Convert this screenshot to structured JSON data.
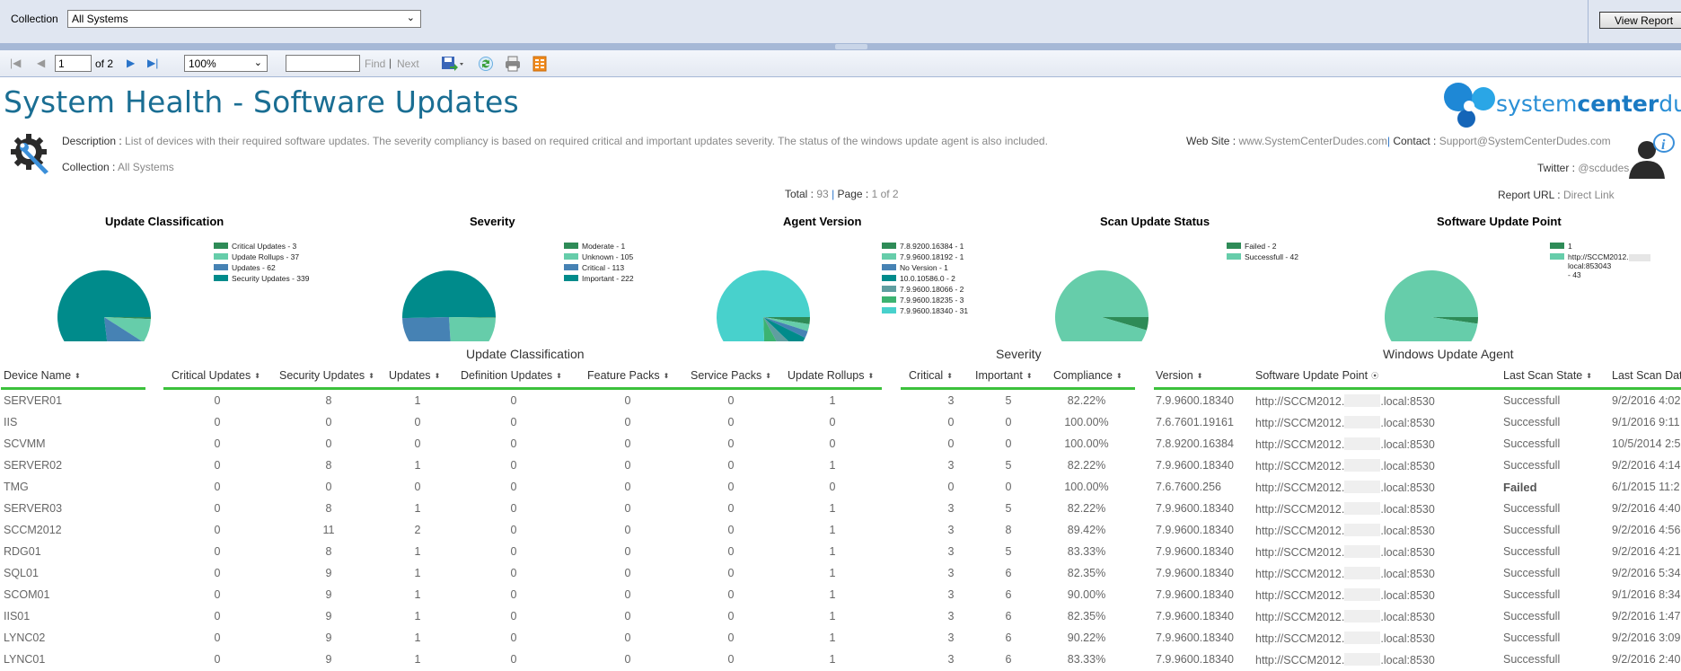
{
  "parameters": {
    "collection_label": "Collection",
    "collection_value": "All Systems",
    "view_report_label": "View Report"
  },
  "toolbar": {
    "page_current": "1",
    "page_of": "of 2",
    "zoom": "100%",
    "find_value": "",
    "find_label": "Find",
    "find_separator": "|",
    "next_label": "Next"
  },
  "report": {
    "title": "System Health - Software Updates",
    "description_label": "Description :",
    "description": "List of devices with their required software updates. The severity compliancy is based on required critical and important updates severity. The status of the windows update agent is also included.",
    "collection_label": "Collection :",
    "collection": "All Systems",
    "website_label": "Web Site :",
    "website": "www.SystemCenterDudes.com",
    "contact_label": "Contact :",
    "contact": "Support@SystemCenterDudes.com",
    "twitter_label": "Twitter :",
    "twitter": "@scdudes",
    "report_url_label": "Report URL :",
    "report_url": "Direct Link",
    "total_label": "Total :",
    "total": "93",
    "page_label": "Page :",
    "page": "1 of 2",
    "logo_text_a": "system",
    "logo_text_b": "center",
    "logo_text_c": "dudes"
  },
  "chart_data": [
    {
      "type": "pie",
      "title": "Update Classification",
      "slices": [
        {
          "label": "Critical Updates - 3",
          "name": "Critical Updates",
          "value": 3,
          "color": "#2e8b57"
        },
        {
          "label": "Update Rollups - 37",
          "name": "Update Rollups",
          "value": 37,
          "color": "#66cdaa"
        },
        {
          "label": "Updates - 62",
          "name": "Updates",
          "value": 62,
          "color": "#4682b4"
        },
        {
          "label": "Security Updates - 339",
          "name": "Security Updates",
          "value": 339,
          "color": "#008b8b"
        }
      ],
      "legend": "right"
    },
    {
      "type": "pie",
      "title": "Severity",
      "slices": [
        {
          "label": "Moderate - 1",
          "name": "Moderate",
          "value": 1,
          "color": "#2e8b57"
        },
        {
          "label": "Unknown - 105",
          "name": "Unknown",
          "value": 105,
          "color": "#66cdaa"
        },
        {
          "label": "Critical - 113",
          "name": "Critical",
          "value": 113,
          "color": "#4682b4"
        },
        {
          "label": "Important - 222",
          "name": "Important",
          "value": 222,
          "color": "#008b8b"
        }
      ],
      "legend": "right"
    },
    {
      "type": "pie",
      "title": "Agent Version",
      "slices": [
        {
          "label": "7.8.9200.16384 - 1",
          "name": "7.8.9200.16384",
          "value": 1,
          "color": "#2e8b57"
        },
        {
          "label": "7.9.9600.18192 - 1",
          "name": "7.9.9600.18192",
          "value": 1,
          "color": "#66cdaa"
        },
        {
          "label": "No Version - 1",
          "name": "No Version",
          "value": 1,
          "color": "#4682b4"
        },
        {
          "label": "10.0.10586.0 - 2",
          "name": "10.0.10586.0",
          "value": 2,
          "color": "#008b8b"
        },
        {
          "label": "7.9.9600.18066 - 2",
          "name": "7.9.9600.18066",
          "value": 2,
          "color": "#5f9ea0"
        },
        {
          "label": "7.9.9600.18235 - 3",
          "name": "7.9.9600.18235",
          "value": 3,
          "color": "#3cb371"
        },
        {
          "label": "7.9.9600.18340 - 31",
          "name": "7.9.9600.18340",
          "value": 31,
          "color": "#48d1cc"
        }
      ],
      "legend": "right"
    },
    {
      "type": "pie",
      "title": "Scan Update Status",
      "slices": [
        {
          "label": "Failed - 2",
          "name": "Failed",
          "value": 2,
          "color": "#2e8b57"
        },
        {
          "label": "Successfull - 42",
          "name": "Successfull",
          "value": 42,
          "color": "#66cdaa"
        }
      ],
      "legend": "right"
    },
    {
      "type": "pie",
      "title": "Software Update Point",
      "slices": [
        {
          "label": "1",
          "name": "(blank)",
          "value": 1,
          "color": "#2e8b57"
        },
        {
          "label": "http://SCCM2012.",
          "label_suffix": "local:8530 - 43",
          "name": "http://SCCM2012.local:8530",
          "value": 43,
          "color": "#66cdaa"
        }
      ],
      "legend": "right"
    }
  ],
  "table": {
    "groups": {
      "update_classification": "Update Classification",
      "severity": "Severity",
      "windows_update_agent": "Windows Update Agent"
    },
    "columns": [
      "Device Name",
      "Critical Updates",
      "Security Updates",
      "Updates",
      "Definition Updates",
      "Feature Packs",
      "Service Packs",
      "Update Rollups",
      "Critical",
      "Important",
      "Compliance",
      "Version",
      "Software Update Point",
      "Last Scan State",
      "Last Scan Date"
    ],
    "rows": [
      [
        "SERVER01",
        "0",
        "8",
        "1",
        "0",
        "0",
        "0",
        "1",
        "3",
        "5",
        "82.22%",
        "7.9.9600.18340",
        "http://SCCM2012.",
        ".local:8530",
        "Successfull",
        "9/2/2016 4:02"
      ],
      [
        "IIS",
        "0",
        "0",
        "0",
        "0",
        "0",
        "0",
        "0",
        "0",
        "0",
        "100.00%",
        "7.6.7601.19161",
        "http://SCCM2012.",
        ".local:8530",
        "Successfull",
        "9/1/2016 9:11"
      ],
      [
        "SCVMM",
        "0",
        "0",
        "0",
        "0",
        "0",
        "0",
        "0",
        "0",
        "0",
        "100.00%",
        "7.8.9200.16384",
        "http://SCCM2012.",
        ".local:8530",
        "Successfull",
        "10/5/2014 2:5"
      ],
      [
        "SERVER02",
        "0",
        "8",
        "1",
        "0",
        "0",
        "0",
        "1",
        "3",
        "5",
        "82.22%",
        "7.9.9600.18340",
        "http://SCCM2012.",
        ".local:8530",
        "Successfull",
        "9/2/2016 4:14"
      ],
      [
        "TMG",
        "0",
        "0",
        "0",
        "0",
        "0",
        "0",
        "0",
        "0",
        "0",
        "100.00%",
        "7.6.7600.256",
        "http://SCCM2012.",
        ".local:8530",
        "Failed",
        "6/1/2015 11:2"
      ],
      [
        "SERVER03",
        "0",
        "8",
        "1",
        "0",
        "0",
        "0",
        "1",
        "3",
        "5",
        "82.22%",
        "7.9.9600.18340",
        "http://SCCM2012.",
        ".local:8530",
        "Successfull",
        "9/2/2016 4:40"
      ],
      [
        "SCCM2012",
        "0",
        "11",
        "2",
        "0",
        "0",
        "0",
        "1",
        "3",
        "8",
        "89.42%",
        "7.9.9600.18340",
        "http://SCCM2012.",
        ".local:8530",
        "Successfull",
        "9/2/2016 4:56"
      ],
      [
        "RDG01",
        "0",
        "8",
        "1",
        "0",
        "0",
        "0",
        "1",
        "3",
        "5",
        "83.33%",
        "7.9.9600.18340",
        "http://SCCM2012.",
        ".local:8530",
        "Successfull",
        "9/2/2016 4:21"
      ],
      [
        "SQL01",
        "0",
        "9",
        "1",
        "0",
        "0",
        "0",
        "1",
        "3",
        "6",
        "82.35%",
        "7.9.9600.18340",
        "http://SCCM2012.",
        ".local:8530",
        "Successfull",
        "9/2/2016 5:34"
      ],
      [
        "SCOM01",
        "0",
        "9",
        "1",
        "0",
        "0",
        "0",
        "1",
        "3",
        "6",
        "90.00%",
        "7.9.9600.18340",
        "http://SCCM2012.",
        ".local:8530",
        "Successfull",
        "9/1/2016 8:34"
      ],
      [
        "IIS01",
        "0",
        "9",
        "1",
        "0",
        "0",
        "0",
        "1",
        "3",
        "6",
        "82.35%",
        "7.9.9600.18340",
        "http://SCCM2012.",
        ".local:8530",
        "Successfull",
        "9/2/2016 1:47"
      ],
      [
        "LYNC02",
        "0",
        "9",
        "1",
        "0",
        "0",
        "0",
        "1",
        "3",
        "6",
        "90.22%",
        "7.9.9600.18340",
        "http://SCCM2012.",
        ".local:8530",
        "Successfull",
        "9/2/2016 3:09"
      ],
      [
        "LYNC01",
        "0",
        "9",
        "1",
        "0",
        "0",
        "0",
        "1",
        "3",
        "6",
        "83.33%",
        "7.9.9600.18340",
        "http://SCCM2012.",
        ".local:8530",
        "Successfull",
        "9/2/2016 2:40"
      ]
    ]
  }
}
